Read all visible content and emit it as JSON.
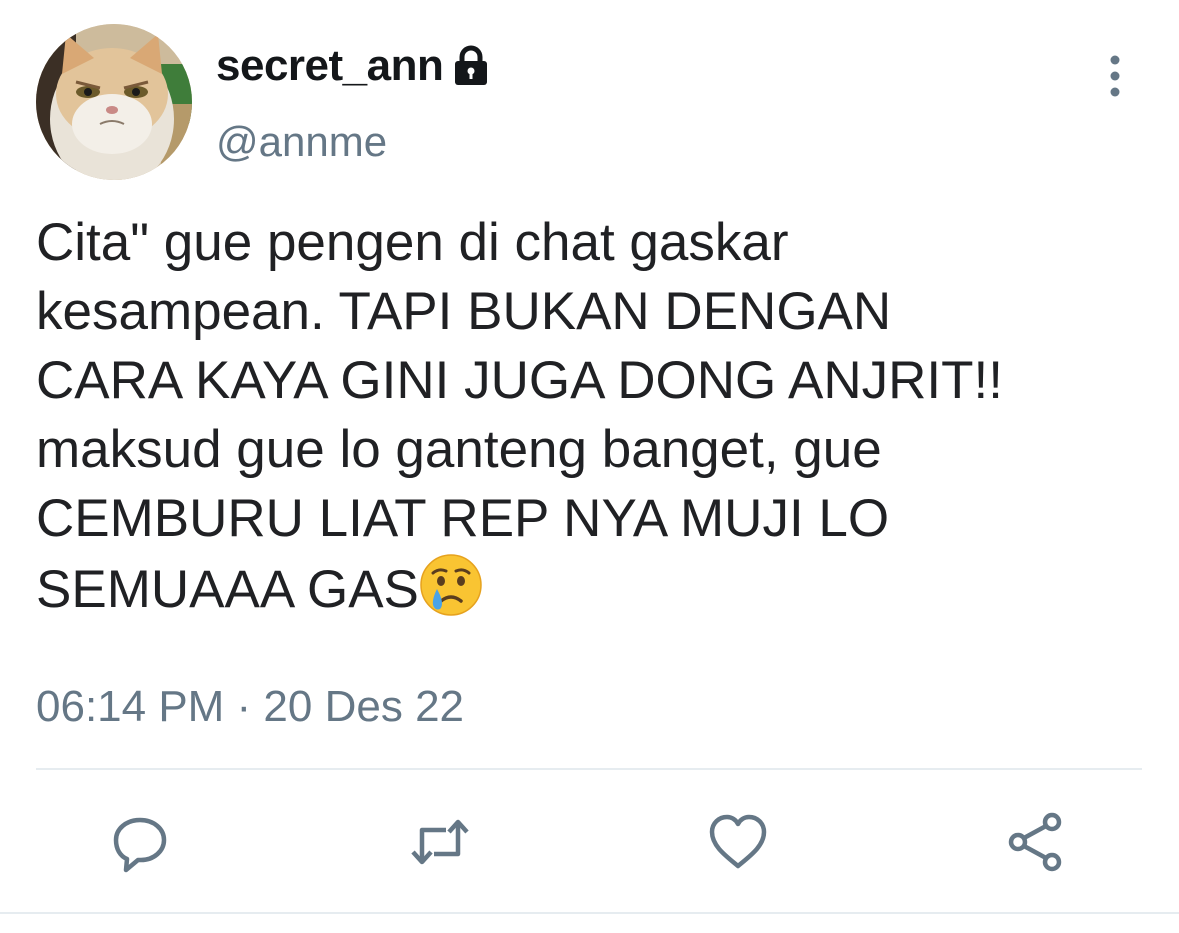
{
  "tweet": {
    "display_name": "secret_ann",
    "handle": "@annme",
    "text_before_emoji": "Cita\" gue pengen di chat gaskar\nkesampean. TAPI BUKAN DENGAN\nCARA KAYA GINI JUGA DONG ANJRIT!!\nmaksud gue lo ganteng banget, gue\nCEMBURU LIAT REP NYA MUJI LO\nSEMUAAA GAS",
    "emoji": "crying-face-emoji",
    "timestamp": "06:14 PM · 20 Des 22",
    "protected_icon": "lock-icon",
    "avatar_description_icon": "avatar-cat-photo"
  },
  "actions": {
    "reply_icon": "reply-icon",
    "retweet_icon": "retweet-icon",
    "like_icon": "heart-icon",
    "share_icon": "share-icon",
    "more_icon": "more-vertical-icon"
  },
  "colors": {
    "text_primary": "#14171a",
    "text_secondary": "#657786",
    "divider": "#e6ecf0",
    "icon": "#657786"
  }
}
